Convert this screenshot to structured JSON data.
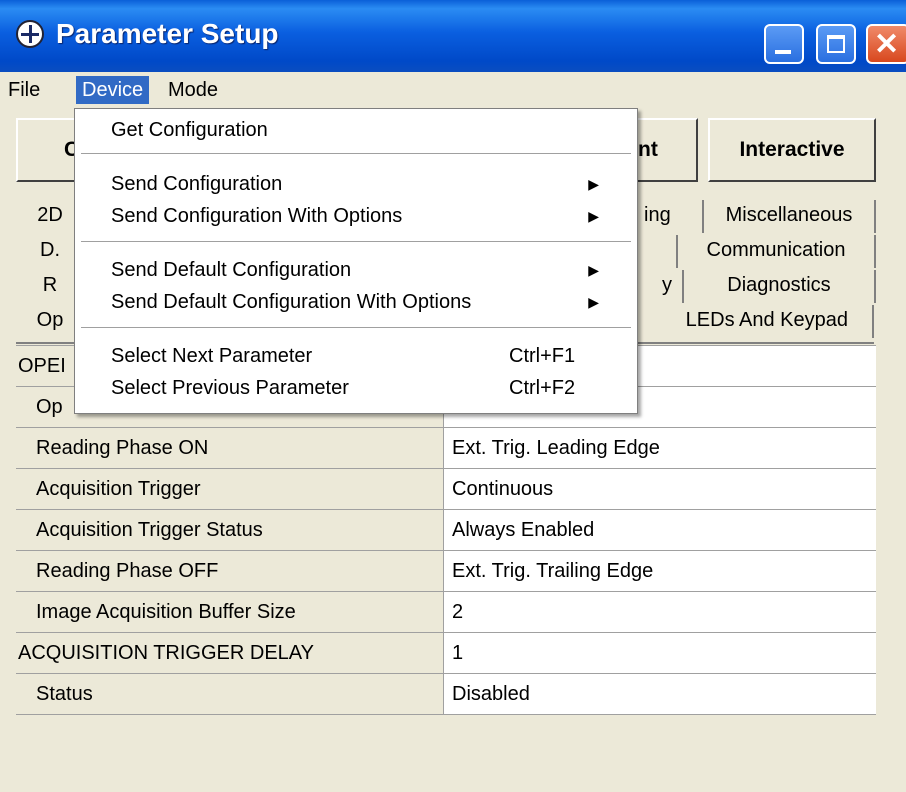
{
  "window": {
    "title": "Parameter Setup"
  },
  "menubar": {
    "items": [
      "File",
      "Device",
      "Mode"
    ]
  },
  "toolbar": {
    "left_partial": "C",
    "mid_partial": "nt",
    "interactive": "Interactive"
  },
  "tabs": {
    "row1": [
      "2D",
      "ing",
      "Miscellaneous"
    ],
    "row2": [
      "D.",
      "Communication"
    ],
    "row3": [
      "R",
      "y",
      "Diagnostics"
    ],
    "row4": [
      "Op",
      "LEDs And Keypad"
    ]
  },
  "grid": {
    "rows": [
      {
        "name": "OPEI",
        "value": ""
      },
      {
        "name": "Op",
        "value": ""
      },
      {
        "name": "Reading Phase ON",
        "value": "Ext. Trig. Leading Edge"
      },
      {
        "name": "Acquisition Trigger",
        "value": "Continuous"
      },
      {
        "name": "Acquisition Trigger Status",
        "value": "Always Enabled"
      },
      {
        "name": "Reading Phase OFF",
        "value": "Ext. Trig. Trailing Edge"
      },
      {
        "name": "Image Acquisition Buffer Size",
        "value": "2"
      },
      {
        "name": "ACQUISITION TRIGGER DELAY",
        "value": "1"
      },
      {
        "name": "Status",
        "value": "Disabled"
      }
    ]
  },
  "device_menu": {
    "get_config": "Get Configuration",
    "send_config": "Send Configuration",
    "send_config_opts": "Send Configuration With Options",
    "send_default": "Send Default Configuration",
    "send_default_opts": "Send Default Configuration With Options",
    "select_next": "Select Next Parameter",
    "select_next_sc": "Ctrl+F1",
    "select_prev": "Select Previous Parameter",
    "select_prev_sc": "Ctrl+F2"
  }
}
